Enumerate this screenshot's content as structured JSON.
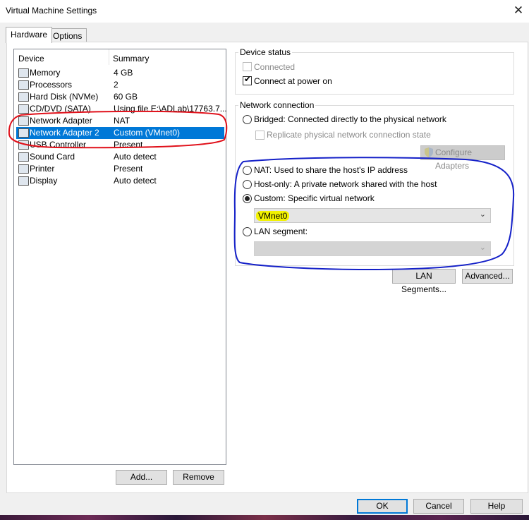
{
  "window": {
    "title": "Virtual Machine Settings",
    "close_glyph": "✕"
  },
  "tabs": [
    {
      "label": "Hardware"
    },
    {
      "label": "Options"
    }
  ],
  "device_list": {
    "header_device": "Device",
    "header_summary": "Summary",
    "rows": [
      {
        "device": "Memory",
        "summary": "4 GB",
        "icon": "memory-icon"
      },
      {
        "device": "Processors",
        "summary": "2",
        "icon": "processor-icon"
      },
      {
        "device": "Hard Disk (NVMe)",
        "summary": "60 GB",
        "icon": "hard-disk-icon"
      },
      {
        "device": "CD/DVD (SATA)",
        "summary": "Using file E:\\ADLab\\17763.7...",
        "icon": "cd-dvd-icon"
      },
      {
        "device": "Network Adapter",
        "summary": "NAT",
        "icon": "network-adapter-icon"
      },
      {
        "device": "Network Adapter 2",
        "summary": "Custom (VMnet0)",
        "icon": "network-adapter-icon"
      },
      {
        "device": "USB Controller",
        "summary": "Present",
        "icon": "usb-icon"
      },
      {
        "device": "Sound Card",
        "summary": "Auto detect",
        "icon": "speaker-icon"
      },
      {
        "device": "Printer",
        "summary": "Present",
        "icon": "printer-icon"
      },
      {
        "device": "Display",
        "summary": "Auto detect",
        "icon": "monitor-icon"
      }
    ],
    "selected_index": 5
  },
  "list_buttons": {
    "add": "Add...",
    "remove": "Remove"
  },
  "device_status": {
    "legend": "Device status",
    "connected": {
      "label": "Connected",
      "checked": false,
      "enabled": false
    },
    "connect_at_power_on": {
      "label": "Connect at power on",
      "checked": true
    }
  },
  "network_connection": {
    "legend": "Network connection",
    "bridged": "Bridged: Connected directly to the physical network",
    "replicate": "Replicate physical network connection state",
    "configure_adapters": "Configure Adapters",
    "nat": "NAT: Used to share the host's IP address",
    "host_only": "Host-only: A private network shared with the host",
    "custom": "Custom: Specific virtual network",
    "custom_value": "VMnet0",
    "lan_segment": "LAN segment:",
    "lan_segment_value": "",
    "selected": "custom"
  },
  "panel_buttons": {
    "lan_segments": "LAN Segments...",
    "advanced": "Advanced..."
  },
  "dialog_buttons": {
    "ok": "OK",
    "cancel": "Cancel",
    "help": "Help"
  },
  "colors": {
    "selection": "#0078d7",
    "annotation_red": "#e0101a",
    "annotation_blue": "#1420c8",
    "highlight_yellow": "#f2f200"
  }
}
